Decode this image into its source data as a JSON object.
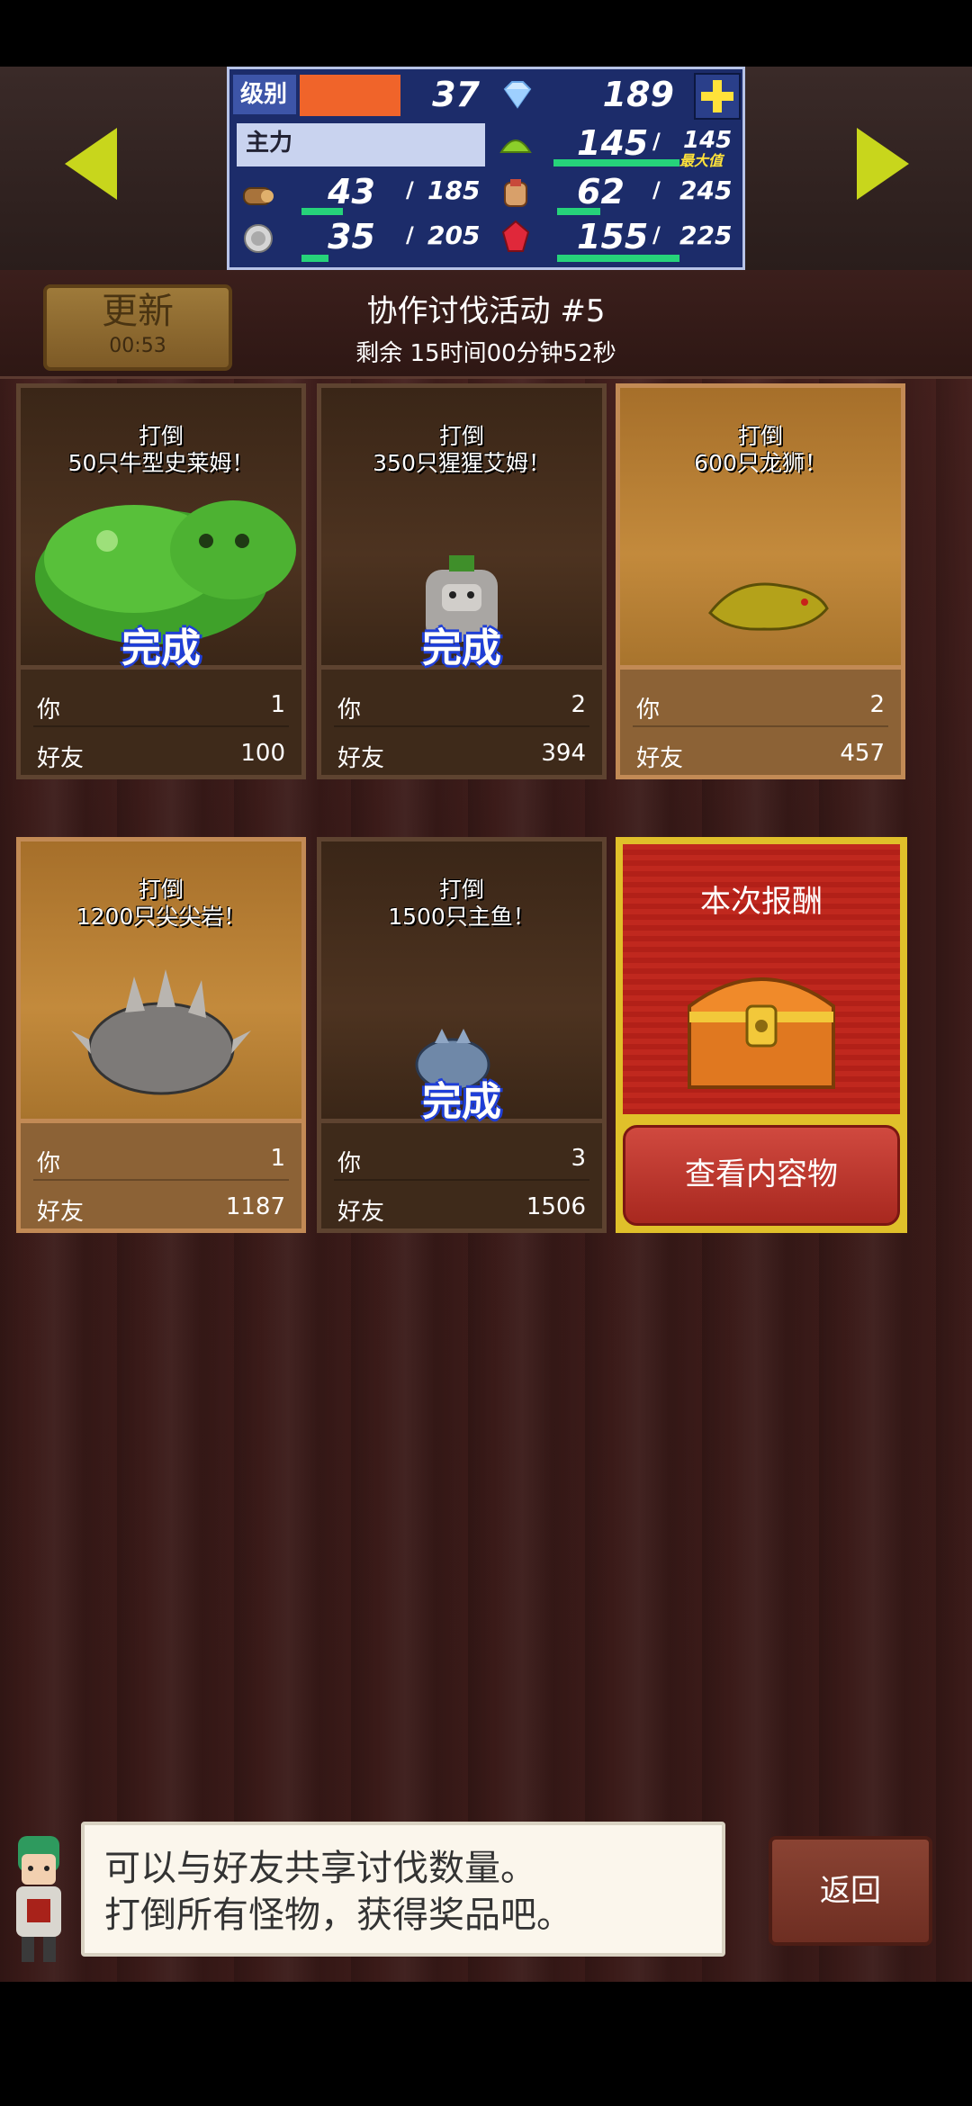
{
  "status": {
    "level_label": "级别",
    "level": "37",
    "level_progress": 0.55,
    "gems": "189",
    "main_label": "主力",
    "crop_current": "145",
    "crop_sep": "/",
    "crop_max": "145",
    "crop_max_tag": "最大值",
    "wood_current": "43",
    "wood_sep": "/",
    "wood_max": "185",
    "meat_current": "62",
    "meat_sep": "/",
    "meat_max": "245",
    "ore_current": "35",
    "ore_sep": "/",
    "ore_max": "205",
    "ruby_current": "155",
    "ruby_sep": "/",
    "ruby_max": "225"
  },
  "header": {
    "refresh_label": "更新",
    "refresh_timer": "00:53",
    "title": "协作讨伐活动 #5",
    "remaining": "剩余 15时间00分钟52秒"
  },
  "cards": [
    {
      "goal_line1": "打倒",
      "goal_line2": "50只牛型史莱姆！",
      "done": "完成",
      "you_label": "你",
      "you": "1",
      "friend_label": "好友",
      "friend": "100"
    },
    {
      "goal_line1": "打倒",
      "goal_line2": "350只猩猩艾姆！",
      "done": "完成",
      "you_label": "你",
      "you": "2",
      "friend_label": "好友",
      "friend": "394"
    },
    {
      "goal_line1": "打倒",
      "goal_line2": "600只龙狮！",
      "done": "",
      "you_label": "你",
      "you": "2",
      "friend_label": "好友",
      "friend": "457"
    },
    {
      "goal_line1": "打倒",
      "goal_line2": "1200只尖尖岩！",
      "done": "",
      "you_label": "你",
      "you": "1",
      "friend_label": "好友",
      "friend": "1187"
    },
    {
      "goal_line1": "打倒",
      "goal_line2": "1500只主鱼！",
      "done": "完成",
      "you_label": "你",
      "you": "3",
      "friend_label": "好友",
      "friend": "1506"
    }
  ],
  "reward": {
    "title": "本次报酬",
    "button": "查看内容物"
  },
  "dialog": {
    "line1": "可以与好友共享讨伐数量。",
    "line2": "打倒所有怪物，获得奖品吧。"
  },
  "back_label": "返回",
  "colors": {
    "accent_green": "#26d37a",
    "arrow_yellow": "#c8d61c",
    "stats_blue": "#1c2c6a"
  }
}
